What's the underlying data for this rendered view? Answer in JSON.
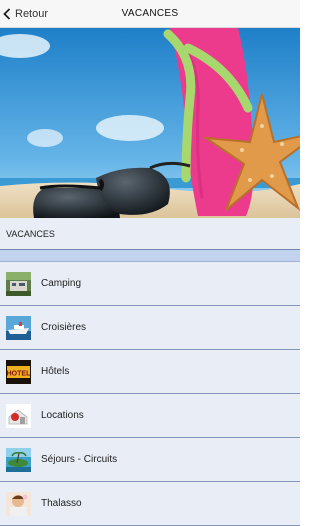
{
  "nav": {
    "back_label": "Retour",
    "title": "VACANCES"
  },
  "section": {
    "title": "VACANCES"
  },
  "items": [
    {
      "label": "Camping",
      "icon": "camping-icon"
    },
    {
      "label": "Croisières",
      "icon": "cruise-ship-icon"
    },
    {
      "label": "Hôtels",
      "icon": "hotel-sign-icon"
    },
    {
      "label": "Locations",
      "icon": "rental-icon"
    },
    {
      "label": "Séjours - Circuits",
      "icon": "island-icon"
    },
    {
      "label": "Thalasso",
      "icon": "spa-icon"
    }
  ]
}
